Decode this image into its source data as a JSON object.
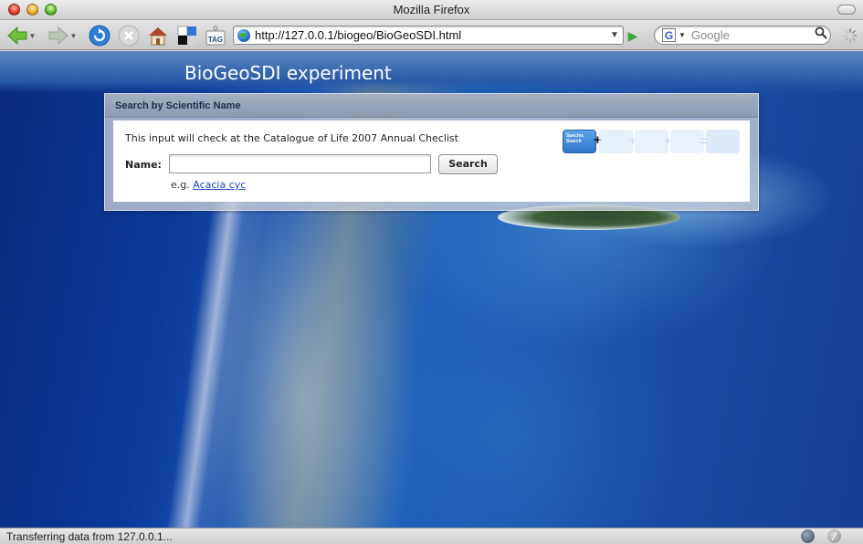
{
  "window": {
    "title": "Mozilla Firefox"
  },
  "toolbar": {
    "url": "http://127.0.0.1/biogeo/BioGeoSDI.html",
    "search_placeholder": "Google",
    "icons": [
      "back-icon",
      "forward-icon",
      "reload-icon",
      "stop-icon",
      "home-icon",
      "delicious-icon",
      "tag-icon",
      "go-icon",
      "magnifier-icon",
      "spinner-icon"
    ]
  },
  "page": {
    "title": "BioGeoSDI experiment",
    "panel": {
      "title": "Search by Scientific Name",
      "info": "This input will check at the Catalogue of Life 2007 Annual Checlist",
      "name_label": "Name:",
      "name_value": "",
      "search_button": "Search",
      "example_prefix": "e.g.",
      "example_link": "Acacia cyc"
    },
    "workflow": {
      "first_step_label": "Species Search"
    }
  },
  "status": {
    "text": "Transferring data from 127.0.0.1..."
  },
  "colors": {
    "accent_link": "#1a44c2",
    "go_green": "#3fa73a"
  }
}
